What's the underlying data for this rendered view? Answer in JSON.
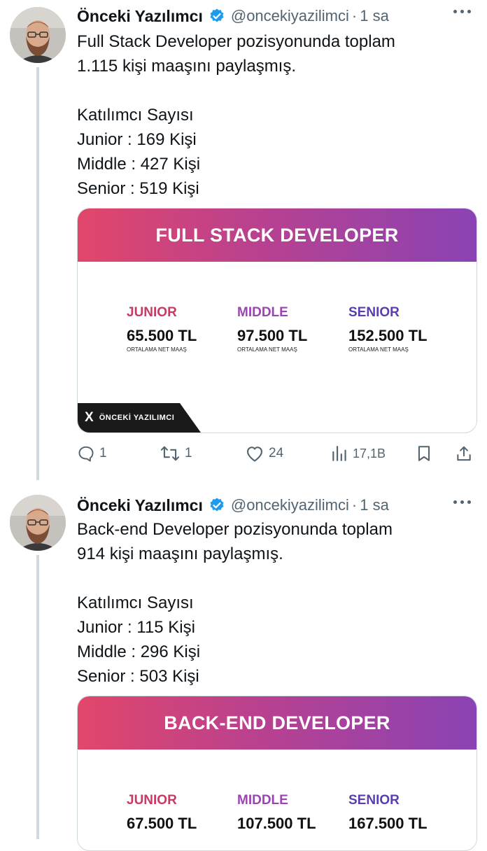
{
  "tweets": [
    {
      "author": {
        "name": "Önceki Yazılımcı",
        "handle": "@oncekiyazilimci",
        "separator": "·",
        "time": "1 sa"
      },
      "text_lines": [
        "Full Stack Developer pozisyonunda toplam",
        "1.115 kişi maaşını paylaşmış.",
        "",
        "Katılımcı Sayısı",
        "Junior : 169 Kişi",
        "Middle : 427 Kişi",
        "Senior : 519 Kişi"
      ],
      "card": {
        "title": "FULL STACK DEVELOPER",
        "levels": [
          {
            "label": "JUNIOR",
            "value": "65.500 TL",
            "caption": "ORTALAMA NET MAAŞ",
            "color": "#c93a63"
          },
          {
            "label": "MIDDLE",
            "value": "97.500 TL",
            "caption": "ORTALAMA NET MAAŞ",
            "color": "#9a45b3"
          },
          {
            "label": "SENIOR",
            "value": "152.500 TL",
            "caption": "ORTALAMA NET MAAŞ",
            "color": "#5a3db0"
          }
        ],
        "watermark": {
          "logo": "X",
          "text": "ÖNCEKİ YAZILIMCI"
        }
      },
      "actions": {
        "replies": "1",
        "reposts": "1",
        "likes": "24",
        "views": "17,1B"
      }
    },
    {
      "author": {
        "name": "Önceki Yazılımcı",
        "handle": "@oncekiyazilimci",
        "separator": "·",
        "time": "1 sa"
      },
      "text_lines": [
        "Back-end Developer pozisyonunda toplam",
        "914 kişi maaşını paylaşmış.",
        "",
        "Katılımcı Sayısı",
        "Junior : 115 Kişi",
        "Middle : 296 Kişi",
        "Senior : 503 Kişi"
      ],
      "card": {
        "title": "BACK-END DEVELOPER",
        "levels": [
          {
            "label": "JUNIOR",
            "value": "67.500 TL",
            "color": "#c93a63"
          },
          {
            "label": "MIDDLE",
            "value": "107.500 TL",
            "color": "#9a45b3"
          },
          {
            "label": "SENIOR",
            "value": "167.500 TL",
            "color": "#5a3db0"
          }
        ]
      }
    }
  ],
  "colors": {
    "verified": "#1d9bf0",
    "muted": "#536471",
    "thread_line": "#cfd9de"
  }
}
